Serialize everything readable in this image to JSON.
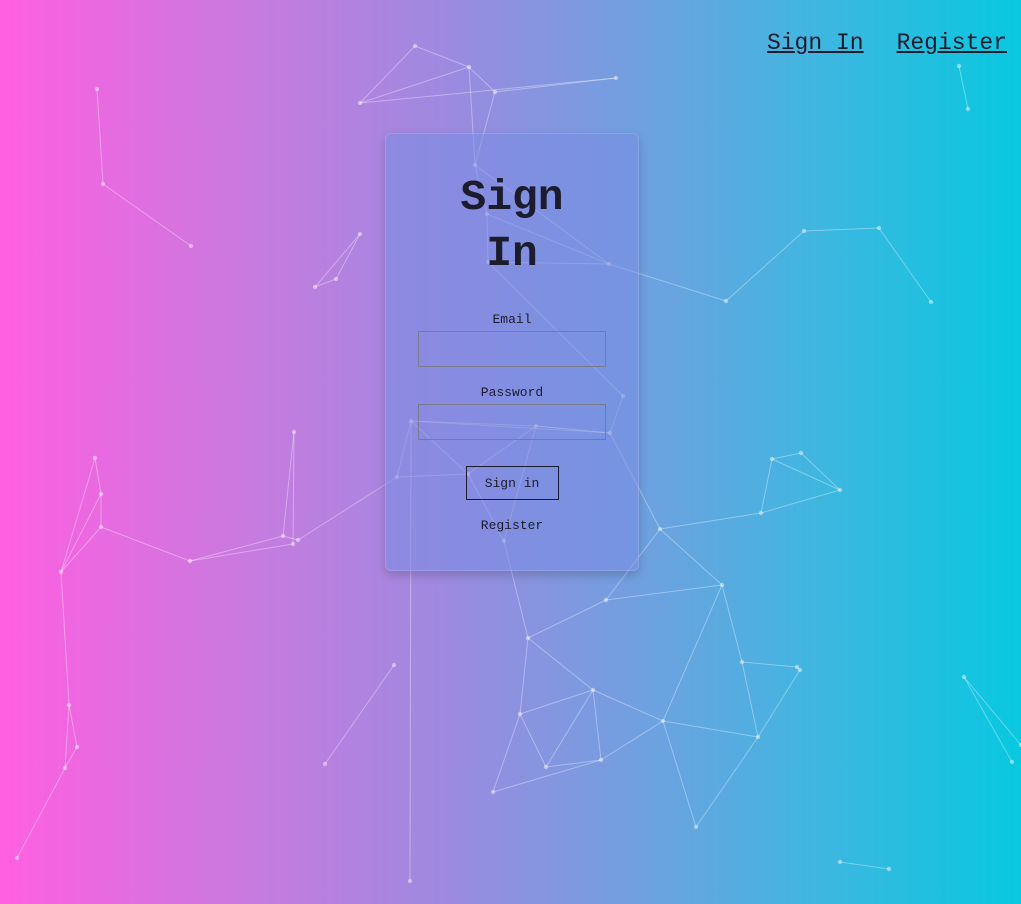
{
  "nav": {
    "sign_in": "Sign In",
    "register": "Register"
  },
  "form": {
    "title": "Sign In",
    "email_label": "Email",
    "email_value": "",
    "password_label": "Password",
    "password_value": "",
    "submit_label": "Sign in",
    "register_link": "Register"
  },
  "colors": {
    "gradient_start": "#ff5fe0",
    "gradient_end": "#08c8e0",
    "text": "#1c1c2c"
  }
}
